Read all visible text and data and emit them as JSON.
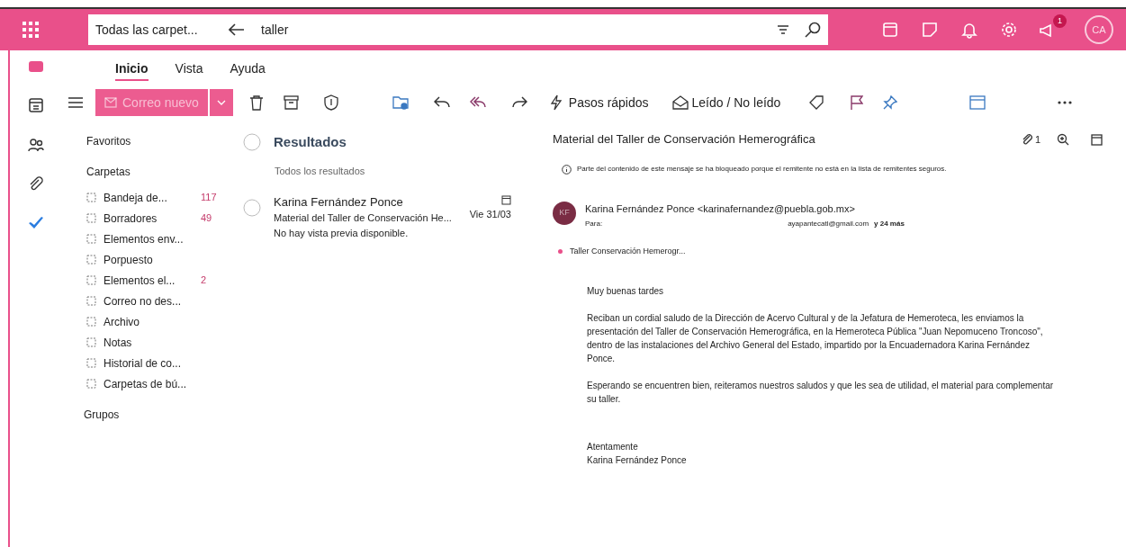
{
  "search": {
    "scope": "Todas las carpet...",
    "query": "taller"
  },
  "notification_badge": {
    "count": "1"
  },
  "account": {
    "initials": "CA"
  },
  "ribbon_tabs": [
    {
      "label": "Inicio",
      "selected": true
    },
    {
      "label": "Vista",
      "selected": false
    },
    {
      "label": "Ayuda",
      "selected": false
    }
  ],
  "toolbar": {
    "new_mail": "Correo nuevo",
    "quick_steps": "Pasos rápidos",
    "read_unread": "Leído / No leído"
  },
  "folder_pane": {
    "favorites": "Favoritos",
    "folders_heading": "Carpetas",
    "folders": [
      {
        "label": "Bandeja de...",
        "count": "117"
      },
      {
        "label": "Borradores",
        "count": "49"
      },
      {
        "label": "Elementos env..."
      },
      {
        "label": "Porpuesto"
      },
      {
        "label": "Elementos el...",
        "count": "2"
      },
      {
        "label": "Correo no des..."
      },
      {
        "label": "Archivo"
      },
      {
        "label": "Notas"
      },
      {
        "label": "Historial de co..."
      },
      {
        "label": "Carpetas de bú..."
      }
    ],
    "groups_heading": "Grupos"
  },
  "results": {
    "title": "Resultados",
    "filter": "Todos los resultados",
    "messages": [
      {
        "sender": "Karina Fernández Ponce",
        "subject": "Material del Taller de Conservación He...",
        "preview": "No hay vista previa disponible.",
        "date": "Vie 31/03"
      }
    ]
  },
  "reading_pane": {
    "subject": "Material del Taller de Conservación Hemerográfica",
    "attachment_count": "1",
    "blocked_notice": "Parte del contenido de este mensaje se ha bloqueado porque el remitente no está en la lista de remitentes seguros.",
    "sender_initials": "KF",
    "from": "Karina Fernández Ponce <karinafernandez@puebla.gob.mx>",
    "to_label": "Para:",
    "to": "ayapantecatl@gmail.com",
    "to_more": "y 24 más",
    "attachment": "Taller Conservación Hemerogr...",
    "body": [
      "Muy buenas tardes",
      "Reciban un cordial saludo de la Dirección de Acervo Cultural y de la Jefatura de Hemeroteca, les enviamos la presentación del Taller de Conservación Hemerográfica, en la Hemeroteca Pública \"Juan Nepomuceno Troncoso\", dentro de las instalaciones del Archivo General del Estado, impartido por la Encuadernadora Karina Fernández Ponce.",
      "Esperando se encuentren bien, reiteramos nuestros saludos y que les sea de utilidad, el material para complementar su taller."
    ],
    "signature": [
      "Atentamente",
      "Karina Fernández Ponce"
    ]
  }
}
